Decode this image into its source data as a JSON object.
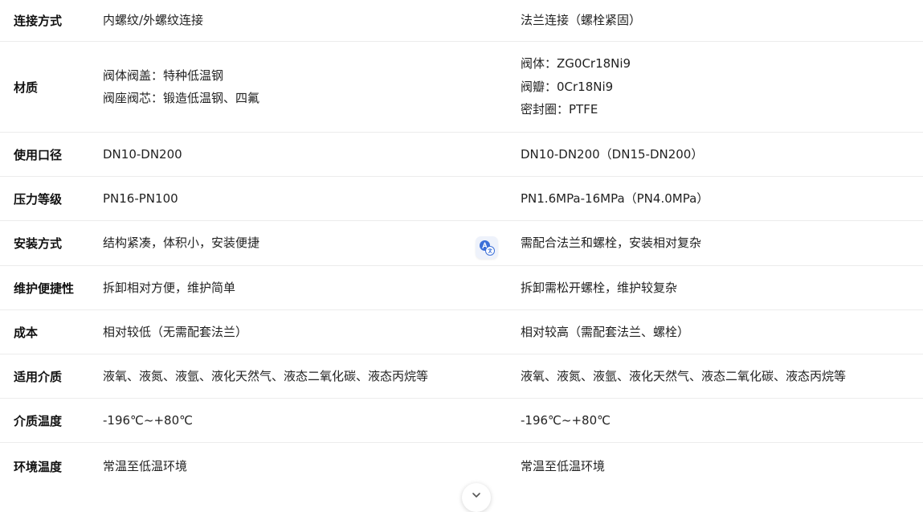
{
  "rows": [
    {
      "label": "连接方式",
      "a": [
        "内螺纹/外螺纹连接"
      ],
      "b": [
        "法兰连接（螺栓紧固）"
      ]
    },
    {
      "label": "材质",
      "a": [
        "阀体阀盖：特种低温钢",
        "阀座阀芯：锻造低温钢、四氟"
      ],
      "b": [
        "阀体：ZG0Cr18Ni9",
        "阀瓣：0Cr18Ni9",
        "密封圈：PTFE"
      ]
    },
    {
      "label": "使用口径",
      "a": [
        "DN10-DN200"
      ],
      "b": [
        "DN10-DN200（DN15-DN200）"
      ]
    },
    {
      "label": "压力等级",
      "a": [
        "PN16-PN100"
      ],
      "b": [
        "PN1.6MPa-16MPa（PN4.0MPa）"
      ]
    },
    {
      "label": "安装方式",
      "a": [
        "结构紧凑，体积小，安装便捷"
      ],
      "b": [
        "需配合法兰和螺栓，安装相对复杂"
      ]
    },
    {
      "label": "维护便捷性",
      "a": [
        "拆卸相对方便，维护简单"
      ],
      "b": [
        "拆卸需松开螺栓，维护较复杂"
      ]
    },
    {
      "label": "成本",
      "a": [
        "相对较低（无需配套法兰）"
      ],
      "b": [
        "相对较高（需配套法兰、螺栓）"
      ]
    },
    {
      "label": "适用介质",
      "a": [
        "液氧、液氮、液氩、液化天然气、液态二氧化碳、液态丙烷等"
      ],
      "b": [
        "液氧、液氮、液氩、液化天然气、液态二氧化碳、液态丙烷等"
      ]
    },
    {
      "label": "介质温度",
      "a": [
        "-196℃~+80℃"
      ],
      "b": [
        "-196℃~+80℃"
      ]
    },
    {
      "label": "环境温度",
      "a": [
        "常温至低温环境"
      ],
      "b": [
        "常温至低温环境"
      ]
    }
  ],
  "icons": {
    "translate": "translate-icon",
    "scroll": "chevron-down-icon"
  },
  "colors": {
    "divider": "#ececec",
    "translate_blue": "#3b6fd8"
  }
}
